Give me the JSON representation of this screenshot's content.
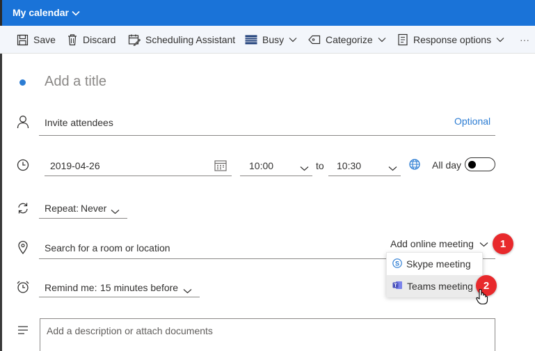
{
  "header": {
    "title": "My calendar"
  },
  "toolbar": {
    "save": "Save",
    "discard": "Discard",
    "scheduling": "Scheduling Assistant",
    "busy": "Busy",
    "categorize": "Categorize",
    "response": "Response options",
    "more": "···"
  },
  "form": {
    "title_placeholder": "Add a title",
    "attendees_placeholder": "Invite attendees",
    "optional_label": "Optional",
    "date": "2019-04-26",
    "start_time": "10:00",
    "to_label": "to",
    "end_time": "10:30",
    "all_day_label": "All day",
    "all_day": false,
    "repeat_label": "Repeat:",
    "repeat_value": "Never",
    "location_placeholder": "Search for a room or location",
    "online_meeting_label": "Add online meeting",
    "remind_label": "Remind me:",
    "remind_value": "15 minutes before",
    "description_placeholder": "Add a description or attach documents"
  },
  "online_meeting_menu": {
    "options": [
      "Skype meeting",
      "Teams meeting"
    ],
    "highlighted": "Teams meeting"
  },
  "annotations": {
    "badge1": "1",
    "badge2": "2"
  },
  "colors": {
    "header_bg": "#1a73d8",
    "accent": "#2b7cd3",
    "badge": "#e8292c",
    "toolbar_bg": "#f3f6fb"
  },
  "icons": [
    "chevron-down-icon",
    "save-icon",
    "trash-icon",
    "scheduling-icon",
    "busy-icon",
    "tag-icon",
    "response-icon",
    "person-icon",
    "clock-icon",
    "calendar-icon",
    "globe-icon",
    "repeat-icon",
    "location-icon",
    "alarm-icon",
    "text-lines-icon",
    "skype-icon",
    "teams-icon",
    "hand-cursor-icon"
  ]
}
